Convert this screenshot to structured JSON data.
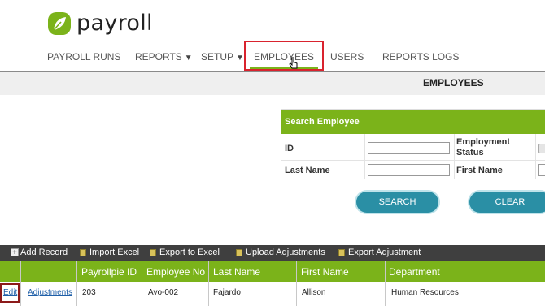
{
  "app": {
    "logo_text": "payroll"
  },
  "nav": {
    "items": [
      {
        "label": "PAYROLL RUNS",
        "caret": ""
      },
      {
        "label": "REPORTS",
        "caret": "▼"
      },
      {
        "label": "SETUP",
        "caret": "▼"
      },
      {
        "label": "EMPLOYEES",
        "caret": ""
      },
      {
        "label": "USERS",
        "caret": ""
      },
      {
        "label": "REPORTS LOGS",
        "caret": ""
      }
    ],
    "active": "EMPLOYEES"
  },
  "page": {
    "title": "EMPLOYEES"
  },
  "search": {
    "header": "Search Employee",
    "fields": {
      "id_label": "ID",
      "id_value": "",
      "employment_status_label": "Employment Status",
      "last_name_label": "Last Name",
      "last_name_value": "",
      "first_name_label": "First Name",
      "first_name_value": ""
    },
    "search_button": "SEARCH",
    "clear_button": "CLEAR"
  },
  "toolbar": {
    "add_record": "Add Record",
    "import_excel": "Import Excel",
    "export_excel": "Export to Excel",
    "upload_adjustments": "Upload Adjustments",
    "export_adjustment": "Export Adjustment"
  },
  "grid": {
    "columns": [
      "",
      "",
      "Payrollpie ID",
      "Employee No",
      "Last Name",
      "First Name",
      "Department"
    ],
    "rows": [
      {
        "edit": "Edit",
        "adjustments": "Adjustments",
        "payrollpie_id": "203",
        "employee_no": "Avo-002",
        "last_name": "Fajardo",
        "first_name": "Allison",
        "department": "Human Resources"
      }
    ]
  },
  "colors": {
    "brand_green": "#7bb31a",
    "button_teal": "#2a8fa5",
    "toolbar_dark": "#3f3f3f",
    "highlight_red": "#d9232e"
  },
  "icons": [
    "leaf-logo-icon",
    "caret-down-icon",
    "mouse-pointer-icon",
    "plus-icon",
    "excel-icon"
  ]
}
